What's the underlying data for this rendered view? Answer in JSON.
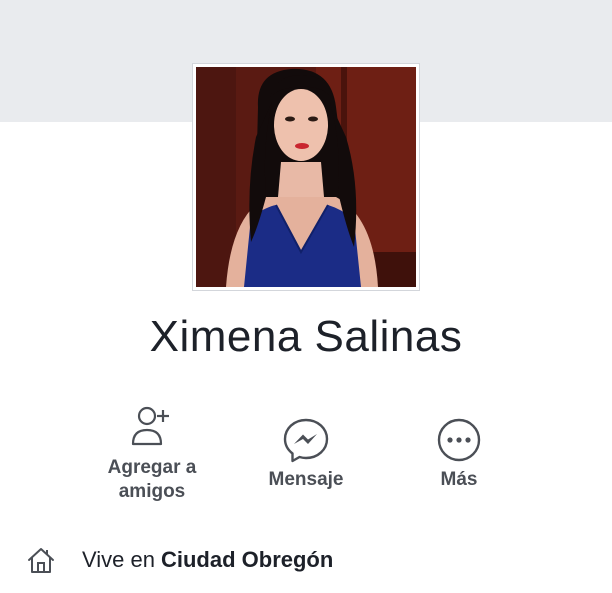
{
  "profile": {
    "name": "Ximena Salinas"
  },
  "actions": {
    "add_friend_line1": "Agregar a",
    "add_friend_line2": "amigos",
    "message": "Mensaje",
    "more": "Más"
  },
  "info": {
    "lives_in_prefix": "Vive en",
    "city": "Ciudad Obregón",
    "icon": "home-icon"
  },
  "colors": {
    "cover": "#e9ebee",
    "text_primary": "#1d2129",
    "text_secondary": "#4b4f56",
    "icon": "#4b4f56"
  }
}
